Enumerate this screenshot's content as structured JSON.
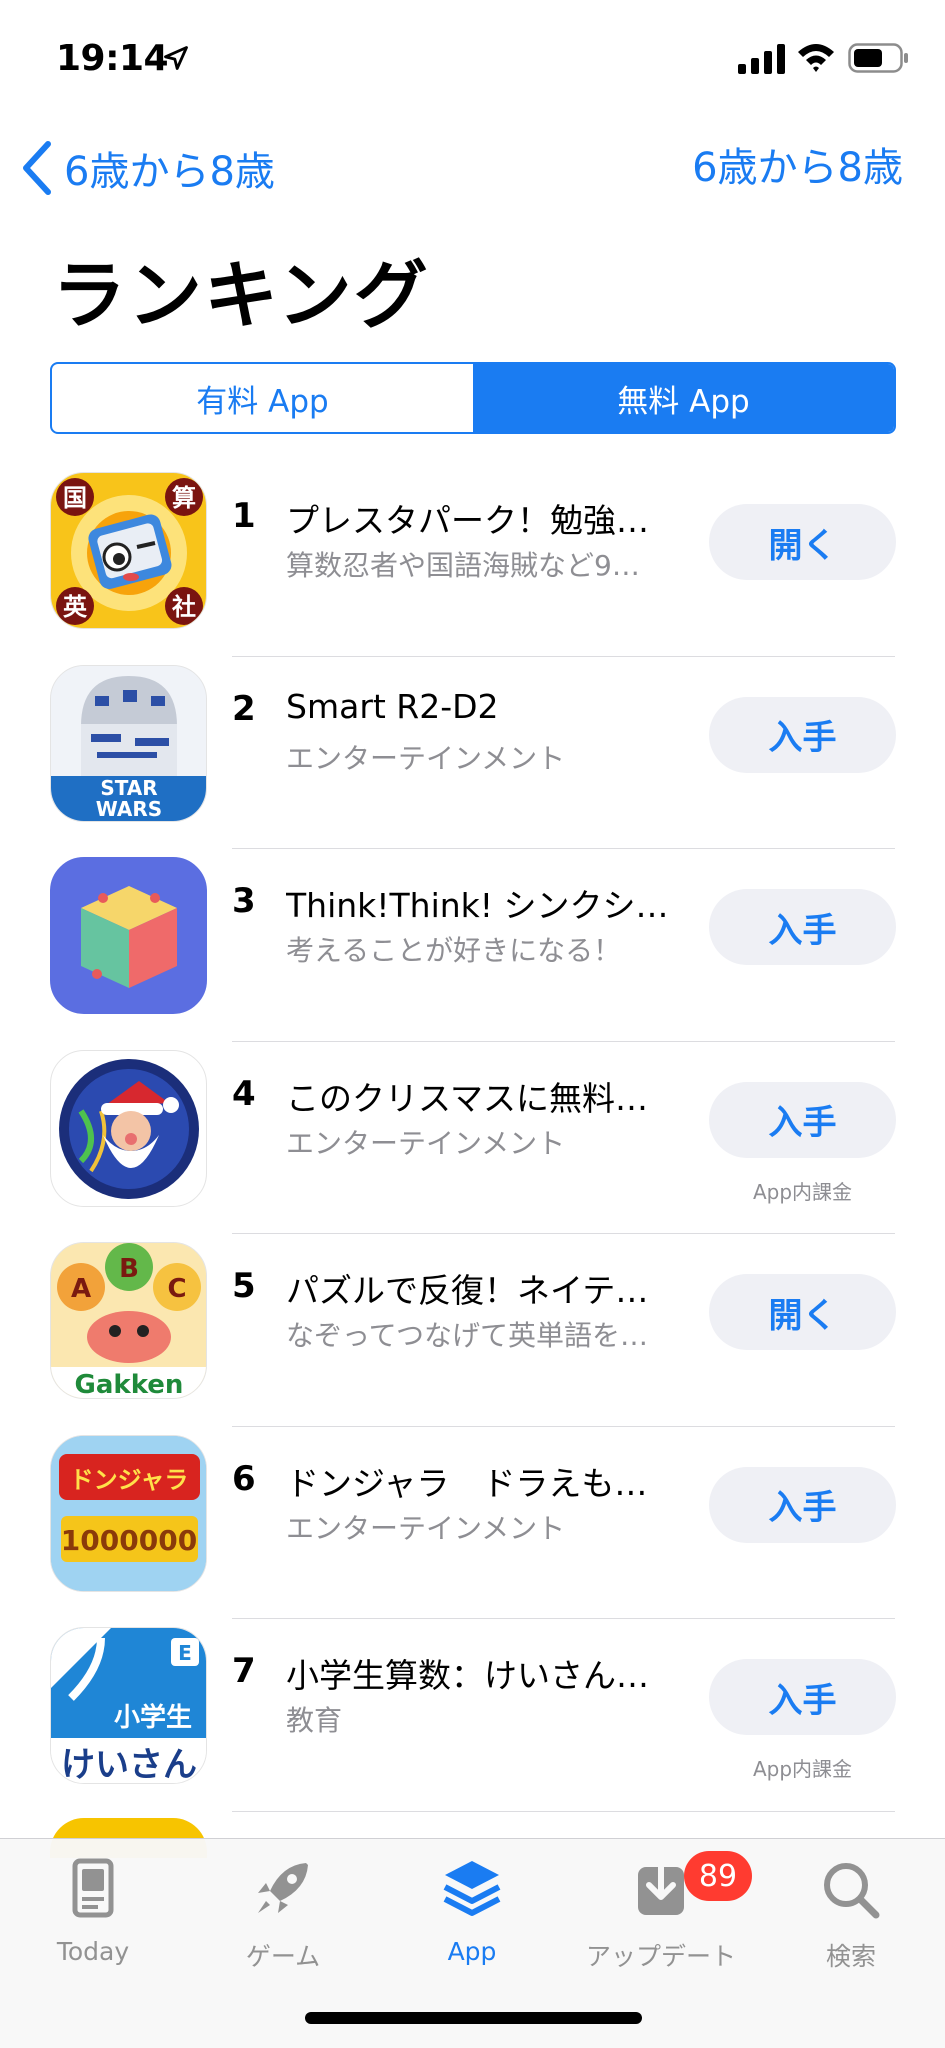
{
  "status_bar": {
    "time": "19:14"
  },
  "nav": {
    "back_label": "6歳から8歳",
    "right_label": "6歳から8歳"
  },
  "title": "ランキング",
  "segments": [
    {
      "label": "有料 App",
      "selected": false
    },
    {
      "label": "無料 App",
      "selected": true
    }
  ],
  "apps": [
    {
      "rank": "1",
      "name": "プレスタパーク！勉強…",
      "subtitle": "算数忍者や国語海賊など9…",
      "button": "開く",
      "iap": ""
    },
    {
      "rank": "2",
      "name": "Smart R2-D2",
      "subtitle": "エンターテインメント",
      "button": "入手",
      "iap": ""
    },
    {
      "rank": "3",
      "name": "Think!Think! シンクシ…",
      "subtitle": "考えることが好きになる！",
      "button": "入手",
      "iap": ""
    },
    {
      "rank": "4",
      "name": "このクリスマスに無料…",
      "subtitle": "エンターテインメント",
      "button": "入手",
      "iap": "App内課金"
    },
    {
      "rank": "5",
      "name": "パズルで反復！ネイテ…",
      "subtitle": "なぞってつなげて英単語を…",
      "button": "開く",
      "iap": ""
    },
    {
      "rank": "6",
      "name": "ドンジャラ　ドラえも…",
      "subtitle": "エンターテインメント",
      "button": "入手",
      "iap": ""
    },
    {
      "rank": "7",
      "name": "小学生算数：けいさん…",
      "subtitle": "教育",
      "button": "入手",
      "iap": "App内課金"
    }
  ],
  "icon_text": {
    "app1": [
      "国",
      "算",
      "英",
      "社"
    ],
    "app2": [
      "STAR",
      "WARS"
    ],
    "app5": [
      "A",
      "B",
      "C",
      "Gakken"
    ],
    "app6": [
      "ドンジャラ",
      "1000000"
    ],
    "app7": [
      "E",
      "小学生",
      "けいさん"
    ]
  },
  "tabbar": {
    "tabs": [
      {
        "label": "Today",
        "icon": "today-icon",
        "selected": false
      },
      {
        "label": "ゲーム",
        "icon": "rocket-icon",
        "selected": false
      },
      {
        "label": "App",
        "icon": "layers-icon",
        "selected": true
      },
      {
        "label": "アップデート",
        "icon": "download-icon",
        "selected": false
      },
      {
        "label": "検索",
        "icon": "search-icon",
        "selected": false
      }
    ],
    "updates_badge": "89"
  },
  "colors": {
    "accent": "#1a7cf2",
    "badge": "#ff3b30",
    "secondary_text": "#8e8e93"
  }
}
